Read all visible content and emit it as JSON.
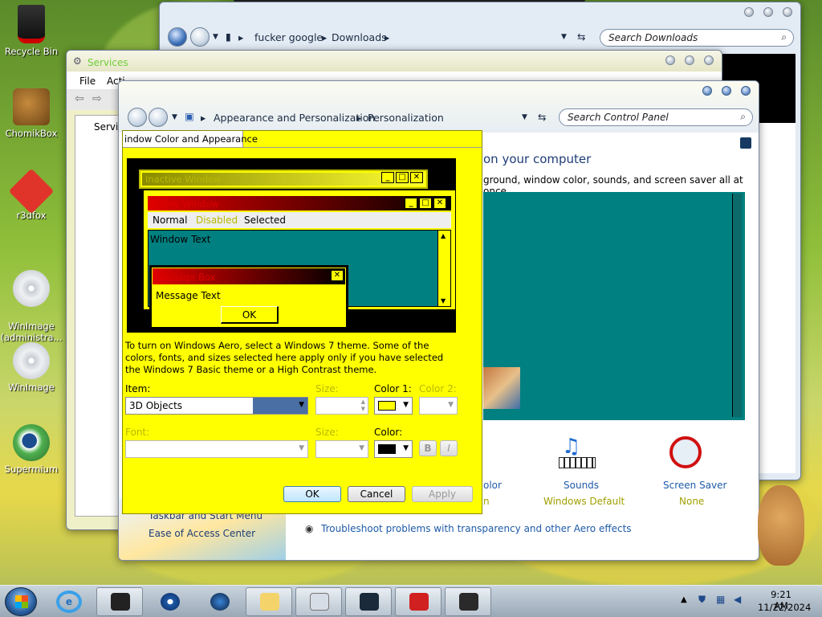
{
  "desktop": {
    "icons": [
      {
        "label": "Recycle Bin"
      },
      {
        "label": "ChomikBox"
      },
      {
        "label": "r3dfox"
      },
      {
        "label": "WinImage\n(administra..."
      },
      {
        "label": "WinImage"
      },
      {
        "label": "Supermium"
      }
    ]
  },
  "explorer": {
    "path": [
      "fucker google",
      "Downloads"
    ],
    "search_placeholder": "Search Downloads"
  },
  "services": {
    "title": "Services",
    "menu": [
      "File",
      "Acti"
    ],
    "tree_item": "Servic"
  },
  "control_panel": {
    "breadcrumb": [
      "Appearance and Personalization",
      "Personalization"
    ],
    "search_placeholder": "Search Control Panel",
    "heading": "on your computer",
    "subheading": "ground, window color, sounds, and screen saver all at once.",
    "items": [
      {
        "title": "olor",
        "sub": "n"
      },
      {
        "title": "Sounds",
        "sub": "Windows Default"
      },
      {
        "title": "Screen Saver",
        "sub": "None"
      }
    ],
    "see_also": [
      "Taskbar and Start Menu",
      "Ease of Access Center"
    ],
    "troubleshoot": "Troubleshoot problems with transparency and other Aero effects"
  },
  "dialog": {
    "tab": "indow Color and Appearance",
    "preview": {
      "inactive_title": "Inactive Window",
      "active_title": "Active Window",
      "menu_normal": "Normal",
      "menu_disabled": "Disabled",
      "menu_selected": "Selected",
      "window_text": "Window Text",
      "msgbox_title": "Message Box",
      "msgbox_text": "Message Text",
      "msgbox_ok": "OK"
    },
    "description": "To turn on Windows Aero, select a Windows 7 theme.  Some of the colors, fonts, and sizes selected here apply only if you have selected the Windows 7 Basic theme or a High Contrast theme.",
    "item_label": "Item:",
    "item_value": "3D Objects",
    "size_label": "Size:",
    "color1_label": "Color 1:",
    "color2_label": "Color 2:",
    "font_label": "Font:",
    "font_size_label": "Size:",
    "font_color_label": "Color:",
    "bold_label": "B",
    "italic_label": "I",
    "ok": "OK",
    "cancel": "Cancel",
    "apply": "Apply",
    "color1_swatch": "#ffff00",
    "font_color_swatch": "#000000"
  },
  "taskbar": {
    "time": "9:21 AM",
    "date": "11/22/2024"
  }
}
